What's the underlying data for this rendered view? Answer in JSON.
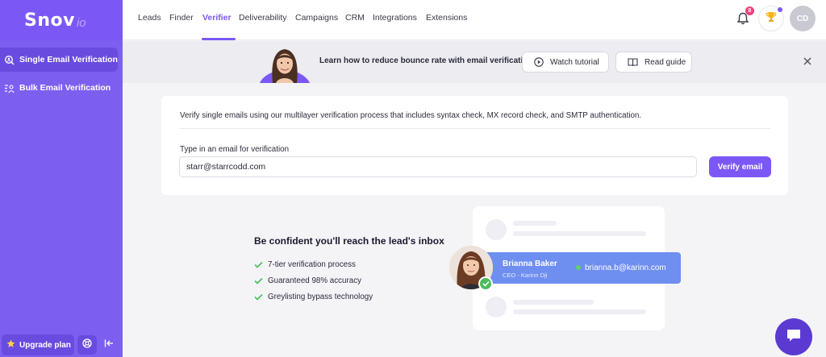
{
  "brand": {
    "logo_main": "Snov",
    "logo_sub": "io"
  },
  "sidebar": {
    "items": [
      {
        "label": "Single Email Verification",
        "active": true,
        "icon": "search-person-icon"
      },
      {
        "label": "Bulk Email Verification",
        "active": false,
        "icon": "list-person-icon"
      }
    ],
    "upgrade_label": "Upgrade plan"
  },
  "nav": {
    "items": [
      {
        "label": "Leads"
      },
      {
        "label": "Finder"
      },
      {
        "label": "Verifier",
        "active": true
      },
      {
        "label": "Deliverability"
      },
      {
        "label": "Campaigns"
      },
      {
        "label": "CRM"
      },
      {
        "label": "Integrations"
      },
      {
        "label": "Extensions"
      }
    ],
    "notifications_count": "8",
    "user_initials": "CD"
  },
  "banner": {
    "text": "Learn how to reduce bounce rate with email verification",
    "watch_label": "Watch tutorial",
    "guide_label": "Read guide"
  },
  "verify_card": {
    "description": "Verify single emails using our multilayer verification process that includes syntax check, MX record check, and SMTP authentication.",
    "field_label": "Type in an email for verification",
    "email_value": "starr@starrcodd.com",
    "button_label": "Verify email"
  },
  "promo": {
    "title": "Be confident you'll reach the lead's inbox",
    "features": [
      "7-tier verification process",
      "Guaranteed 98% accuracy",
      "Greylisting bypass technology"
    ],
    "lead": {
      "name": "Brianna Baker",
      "title": "CEO - Karinn Dji",
      "email": "brianna.b@karinn.com"
    }
  },
  "colors": {
    "accent": "#7b58f6",
    "sidebar": "#7d5ff0",
    "lead_card": "#6e8ef0",
    "success": "#4cbb5c"
  }
}
